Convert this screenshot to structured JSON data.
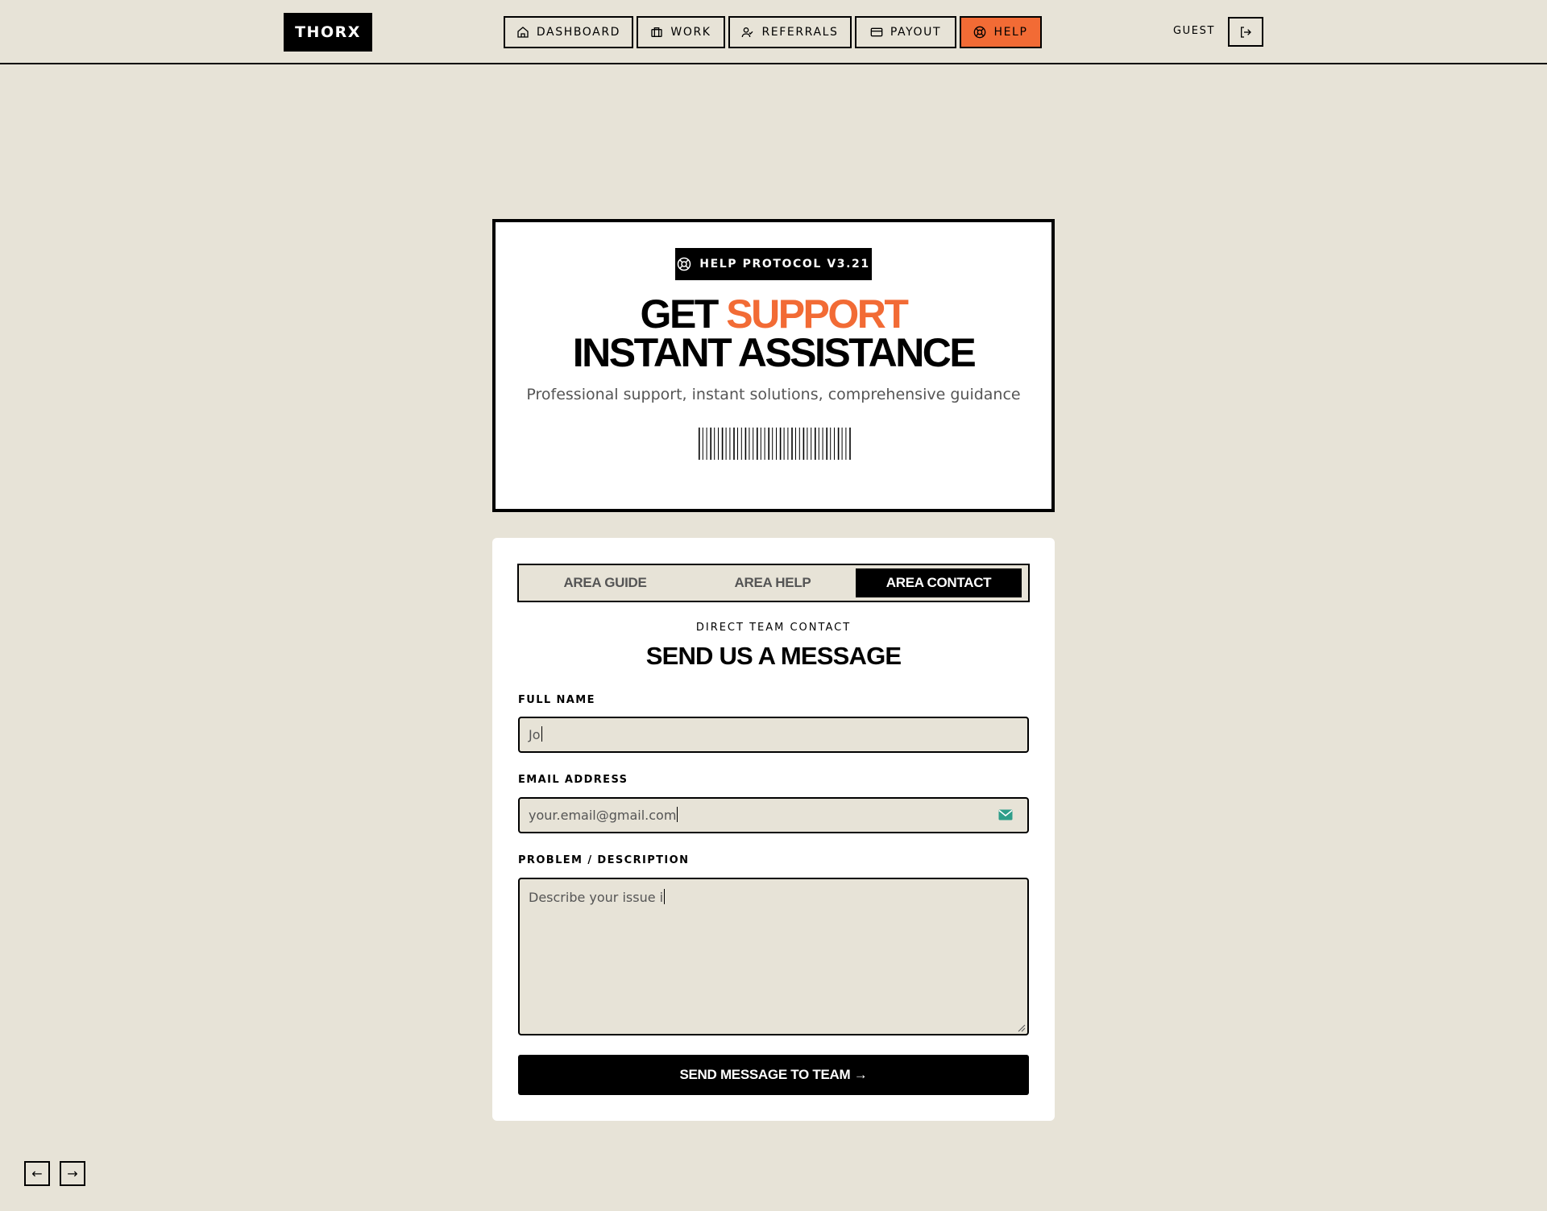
{
  "header": {
    "logo": "THORX",
    "nav": [
      {
        "label": "DASHBOARD",
        "icon": "home-icon",
        "active": false
      },
      {
        "label": "WORK",
        "icon": "briefcase-icon",
        "active": false
      },
      {
        "label": "REFERRALS",
        "icon": "user-plus-icon",
        "active": false
      },
      {
        "label": "PAYOUT",
        "icon": "credit-card-icon",
        "active": false
      },
      {
        "label": "HELP",
        "icon": "lifebuoy-icon",
        "active": true
      }
    ],
    "user_label": "GUEST",
    "logout_icon": "logout-icon"
  },
  "hero": {
    "badge": "HELP PROTOCOL V3.21",
    "badge_icon": "lifebuoy-icon",
    "title_line1_prefix": "GET ",
    "title_line1_accent": "SUPPORT",
    "title_line2": "INSTANT ASSISTANCE",
    "subtitle": "Professional support, instant solutions, comprehensive guidance"
  },
  "tabs": [
    {
      "label": "AREA GUIDE",
      "active": false
    },
    {
      "label": "AREA HELP",
      "active": false
    },
    {
      "label": "AREA CONTACT",
      "active": true
    }
  ],
  "form": {
    "eyebrow": "DIRECT TEAM CONTACT",
    "title": "SEND US A MESSAGE",
    "name_label": "FULL NAME",
    "name_value": "Jo",
    "email_label": "EMAIL ADDRESS",
    "email_value": "your.email@gmail.com",
    "email_icon": "mail-icon",
    "problem_label": "PROBLEM / DESCRIPTION",
    "problem_value": "Describe your issue i",
    "submit_label": "SEND MESSAGE TO TEAM →"
  },
  "pager": {
    "prev": "←",
    "next": "→"
  },
  "colors": {
    "accent": "#f26b35",
    "background": "#e7e3d7",
    "ink": "#000000"
  }
}
